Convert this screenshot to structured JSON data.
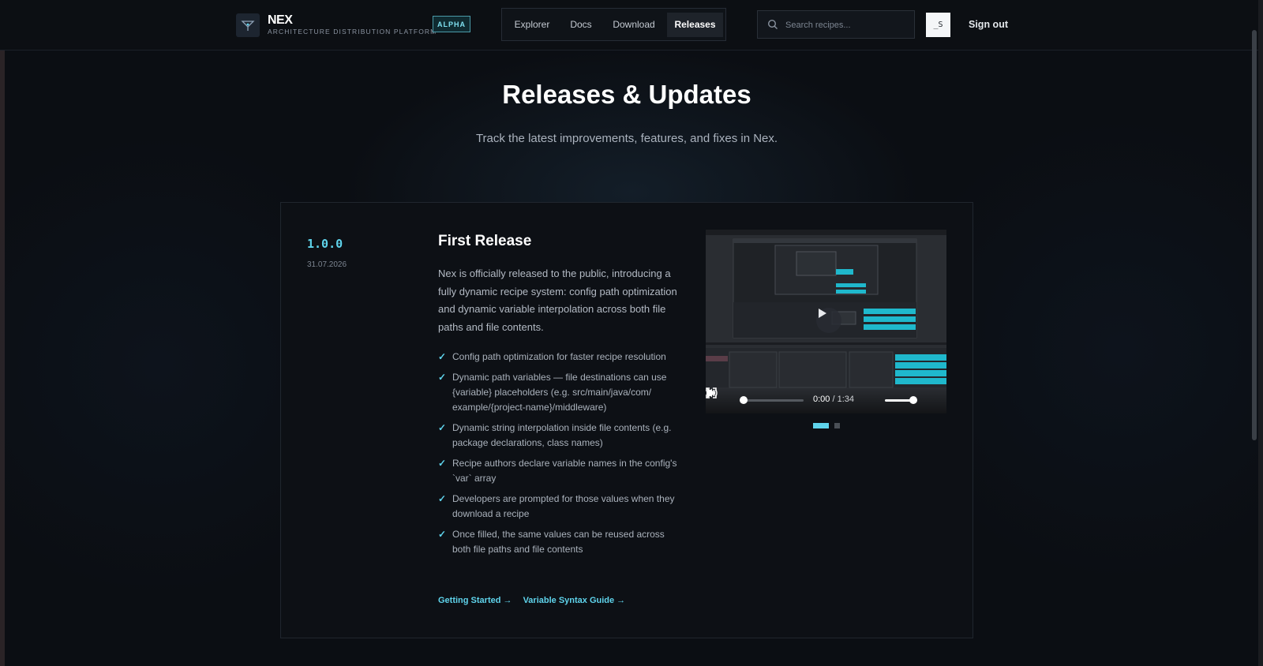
{
  "header": {
    "brand_name": "NEX",
    "brand_subtitle": "ARCHITECTURE DISTRIBUTION PLATFORM",
    "badge": "ALPHA",
    "nav": [
      {
        "label": "Explorer",
        "active": false
      },
      {
        "label": "Docs",
        "active": false
      },
      {
        "label": "Download",
        "active": false
      },
      {
        "label": "Releases",
        "active": true
      }
    ],
    "search_placeholder": "Search recipes...",
    "avatar_initials": "_S",
    "signout_label": "Sign out"
  },
  "hero": {
    "title": "Releases & Updates",
    "subtitle": "Track the latest improvements, features, and fixes in Nex."
  },
  "release": {
    "version": "1.0.0",
    "date": "31.07.2026",
    "title": "First Release",
    "description": "Nex is officially released to the public, introducing a fully dynamic recipe system: config path optimization and dynamic variable interpolation across both file paths and file contents.",
    "features": [
      "Config path optimization for faster recipe resolution",
      "Dynamic path variables — file destinations can use {variable} placeholders (e.g. src/main/java/com/ example/{project-name}/middleware)",
      "Dynamic string interpolation inside file contents (e.g. package declarations, class names)",
      "Recipe authors declare variable names in the config's `var` array",
      "Developers are prompted for those values when they download a recipe",
      "Once filled, the same values can be reused across both file paths and file contents"
    ],
    "links": [
      "Getting Started →",
      "Variable Syntax Guide →"
    ],
    "video": {
      "current_time": "0:00",
      "separator": "/",
      "duration": "1:34",
      "progress": 0
    },
    "carousel": {
      "slides": 2,
      "active": 1
    }
  },
  "colors": {
    "accent": "#5fd4ec",
    "background": "#0b0e13",
    "card_border": "#20262e"
  }
}
